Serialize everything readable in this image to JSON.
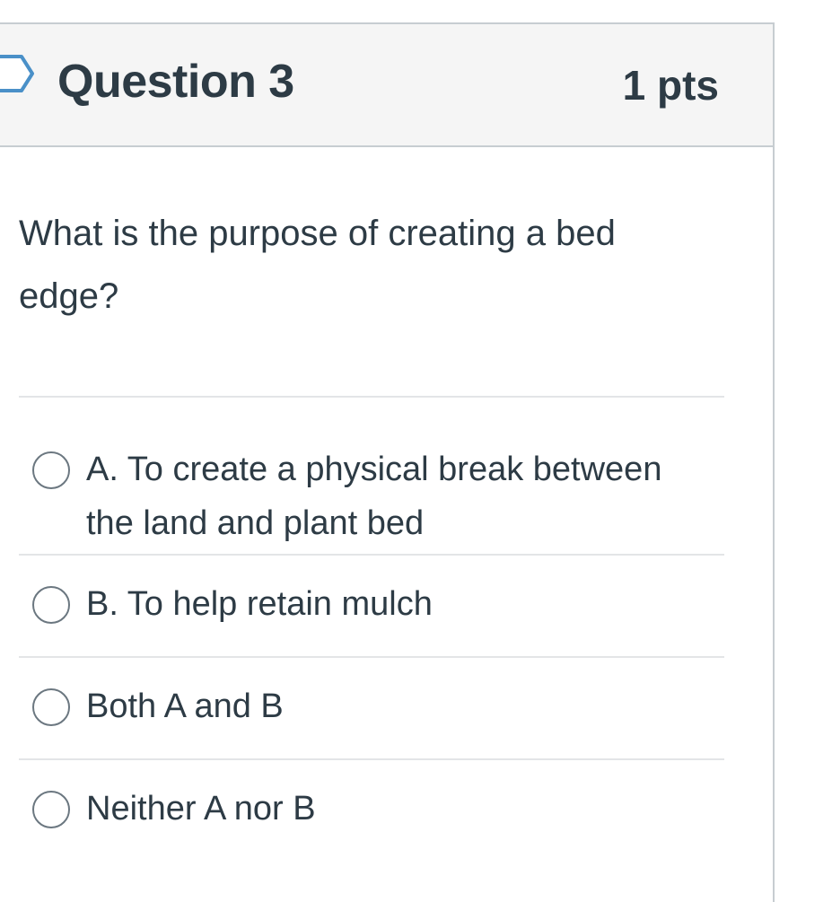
{
  "question": {
    "title": "Question 3",
    "points": "1 pts",
    "text": "What is the purpose of creating a bed edge?",
    "flag_icon": "flag-icon"
  },
  "answers": [
    {
      "label": "A. To create a physical break between the land and plant bed",
      "selected": false
    },
    {
      "label": "B. To help retain mulch",
      "selected": false
    },
    {
      "label": "Both A and B",
      "selected": false
    },
    {
      "label": "Neither A nor B",
      "selected": false
    }
  ],
  "colors": {
    "text": "#2d3b45",
    "header_bg": "#f5f5f5",
    "border": "#c7cdd1",
    "divider": "#e3e5e7",
    "radio_border": "#6b7780"
  }
}
